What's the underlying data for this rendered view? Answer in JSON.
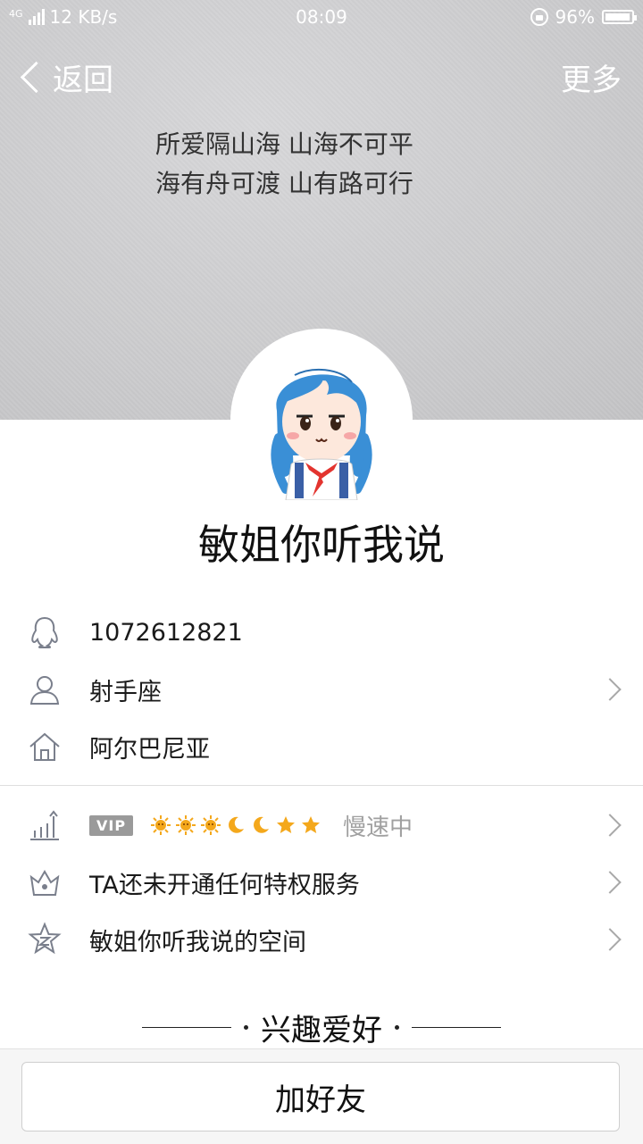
{
  "status_bar": {
    "network": "4G",
    "speed": "12 KB/s",
    "time": "08:09",
    "battery": "96%",
    "battery_level": 0.96
  },
  "nav": {
    "back_label": "返回",
    "more_label": "更多"
  },
  "signature": {
    "line1": "所爱隔山海 山海不可平",
    "line2": "海有舟可渡 山有路可行"
  },
  "profile": {
    "nickname": "敏姐你听我说",
    "qq_number": "1072612821",
    "constellation": "射手座",
    "location": "阿尔巴尼亚"
  },
  "level": {
    "vip_badge": "VIP",
    "icons": [
      "sun",
      "sun",
      "sun",
      "moon",
      "moon",
      "star",
      "star"
    ],
    "status": "慢速中"
  },
  "privilege": {
    "label": "TA还未开通任何特权服务"
  },
  "space": {
    "label": "敏姐你听我说的空间"
  },
  "interests": {
    "title": "兴趣爱好"
  },
  "actions": {
    "add_friend": "加好友"
  },
  "colors": {
    "accent_gold": "#f4a81c",
    "icon_gray": "#7a7f8c",
    "avatar_hair": "#3a8fd6"
  }
}
